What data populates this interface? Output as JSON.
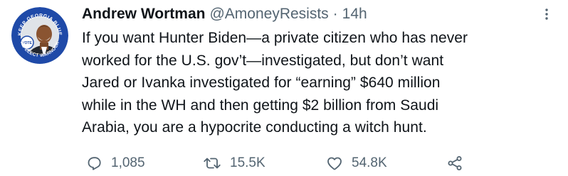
{
  "author": {
    "display_name": "Andrew Wortman",
    "handle": "@AmoneyResists",
    "separator": "·",
    "time": "14h",
    "avatar": {
      "ring_top_text": "KEEP GEORGIA BLUE",
      "ring_bottom_text": "RE-ELECT WARNOCK",
      "badge_text": "VOTE",
      "ring_color": "#1f4aa8",
      "badge_color": "#1f4aa8"
    }
  },
  "tweet": {
    "text": "If you want Hunter Biden—a private citizen who has never\nworked for the U.S. gov’t—investigated, but don’t want\nJared or Ivanka investigated for “earning” $640 million\nwhile in the WH and then getting $2 billion from Saudi\nArabia, you are a hypocrite conducting a witch hunt."
  },
  "actions": {
    "reply_count": "1,085",
    "retweet_count": "15.5K",
    "like_count": "54.8K"
  },
  "icons": {
    "more": "more-vertical-icon",
    "reply": "reply-icon",
    "retweet": "retweet-icon",
    "like": "heart-icon",
    "share": "share-icon"
  },
  "colors": {
    "text": "#0f1419",
    "secondary": "#536471",
    "background": "#ffffff"
  }
}
